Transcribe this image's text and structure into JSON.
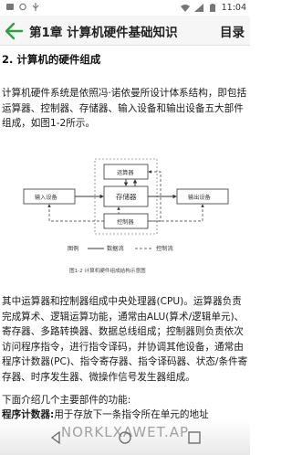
{
  "status_bar": {
    "time": "11:04",
    "icons": [
      "notification-icon",
      "sync-icon",
      "usb-icon",
      "wifi-icon",
      "signal-icon",
      "battery-icon"
    ]
  },
  "app_bar": {
    "title": "第1章 计算机硬件基础知识",
    "toc_label": "目录",
    "accent_color": "#2e9e3e"
  },
  "article": {
    "section_heading": "2. 计算机的硬件组成",
    "paragraph_1": "计算机硬件系统是依照冯·诺依曼所设计体系结构，即包括运算器、控制器、存储器、输入设备和输出设备五大部件组成，如图1-2所示。",
    "paragraph_2": "其中运算器和控制器组成中央处理器(CPU)。运算器负责完成算术、逻辑运算功能，通常由ALU(算术/逻辑单元)、寄存器、多路转换器、数据总线组成；控制器则负责依次访问程序指令，进行指令译码，并协调其他设备，通常由程序计数器(PC)、指令寄存器、指令译码器、状态/条件寄存器、时序发生器、微操作信号发生器组成。",
    "paragraph_3": "下面介绍几个主要部件的功能:",
    "paragraph_4_term": "程序计数器:",
    "paragraph_4_text": "用于存放下一条指令所在单元的地址"
  },
  "figure": {
    "labels": {
      "alu": "运算器",
      "memory": "存储器",
      "control": "控制器",
      "input": "输入设备",
      "output": "输出设备",
      "data_flow": "数据流",
      "control_flow": "控制流",
      "legend_prefix": "图例"
    },
    "caption": "图1-2  计算机硬件组成结构示意图"
  },
  "watermark": "NORKLXAWET.AP"
}
